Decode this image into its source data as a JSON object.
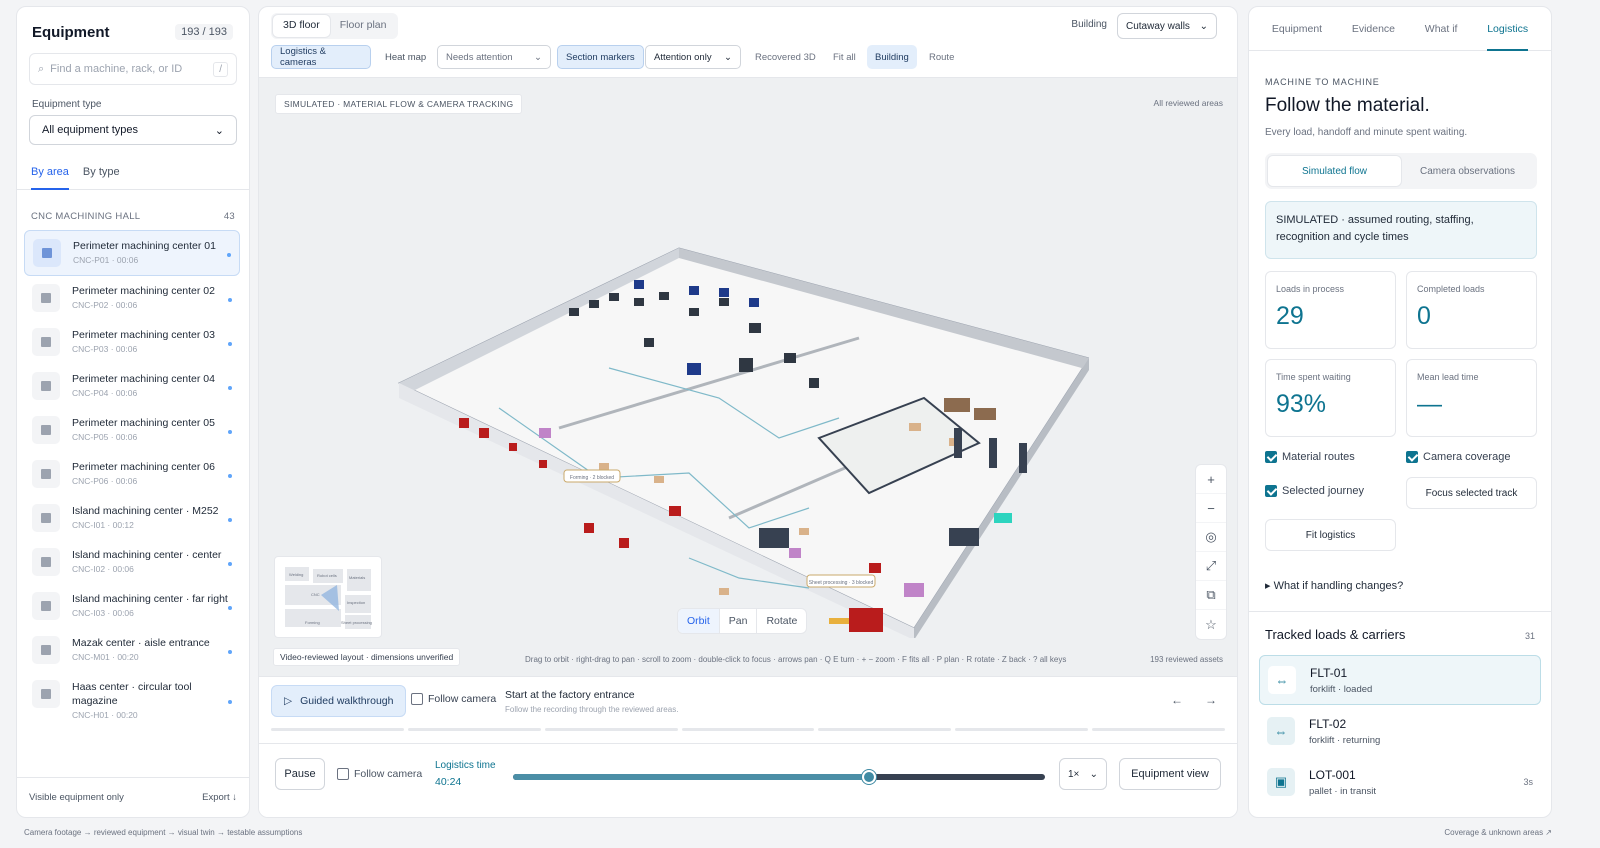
{
  "left": {
    "title": "Equipment",
    "count": "193 / 193",
    "search_placeholder": "Find a machine, rack, or ID",
    "search_shortcut": "/",
    "type_label": "Equipment type",
    "type_value": "All equipment types",
    "tabs": [
      "By area",
      "By type"
    ],
    "section_title": "CNC MACHINING HALL",
    "section_count": "43",
    "items": [
      {
        "name": "Perimeter machining center 01",
        "id": "CNC-P01 · 00:06"
      },
      {
        "name": "Perimeter machining center 02",
        "id": "CNC-P02 · 00:06"
      },
      {
        "name": "Perimeter machining center 03",
        "id": "CNC-P03 · 00:06"
      },
      {
        "name": "Perimeter machining center 04",
        "id": "CNC-P04 · 00:06"
      },
      {
        "name": "Perimeter machining center 05",
        "id": "CNC-P05 · 00:06"
      },
      {
        "name": "Perimeter machining center 06",
        "id": "CNC-P06 · 00:06"
      },
      {
        "name": "Island machining center · M252",
        "id": "CNC-I01 · 00:12"
      },
      {
        "name": "Island machining center · center",
        "id": "CNC-I02 · 00:06"
      },
      {
        "name": "Island machining center · far right",
        "id": "CNC-I03 · 00:06"
      },
      {
        "name": "Mazak center · aisle entrance",
        "id": "CNC-M01 · 00:20"
      },
      {
        "name": "Haas center · circular tool magazine",
        "id": "CNC-H01 · 00:20"
      }
    ],
    "footer_left": "Visible equipment only",
    "footer_right": "Export ↓"
  },
  "center": {
    "view_tabs": [
      "3D floor",
      "Floor plan"
    ],
    "building_label": "Building",
    "building_value": "Cutaway walls",
    "chips": {
      "logistics": "Logistics & cameras",
      "heatmap": "Heat map",
      "needs": "Needs attention",
      "section": "Section markers",
      "attention": "Attention only",
      "recovered": "Recovered 3D",
      "fitall": "Fit all",
      "building": "Building",
      "route": "Route"
    },
    "sim_tag": "SIMULATED · MATERIAL FLOW & CAMERA TRACKING",
    "reviewed_areas": "All reviewed areas",
    "scene_labels": {
      "forming": "Forming · 2 blocked",
      "sheet": "Sheet processing · 3 blocked"
    },
    "minimap_labels": [
      "Welding",
      "Robot cells",
      "Materials",
      "CNC",
      "Inspection",
      "Forming",
      "Sheet processing"
    ],
    "orbit_modes": [
      "Orbit",
      "Pan",
      "Rotate"
    ],
    "video_tag": "Video-reviewed layout · dimensions unverified",
    "hint": "Drag to orbit · right-drag to pan · scroll to zoom · double-click to focus · arrows pan · Q E turn · + − zoom · F fits all · P plan · R rotate · Z back · ? all keys",
    "reviewed_assets": "193 reviewed assets",
    "walkthrough": "Guided walkthrough",
    "follow_camera": "Follow camera",
    "walk_title": "Start at the factory entrance",
    "walk_sub": "Follow the recording through the reviewed areas.",
    "pause": "Pause",
    "logistics_time_label": "Logistics time",
    "logistics_time": "40:24",
    "timeline_position": 0.67,
    "speed": "1×",
    "equipment_view": "Equipment view"
  },
  "right": {
    "tabs": [
      "Equipment",
      "Evidence",
      "What if",
      "Logistics"
    ],
    "eyebrow": "MACHINE TO MACHINE",
    "title": "Follow the material.",
    "subtitle": "Every load, handoff and minute spent waiting.",
    "modes": [
      "Simulated flow",
      "Camera observations"
    ],
    "sim_note": "SIMULATED · assumed routing, staffing, recognition and cycle times",
    "stats": [
      {
        "label": "Loads in process",
        "value": "29"
      },
      {
        "label": "Completed loads",
        "value": "0"
      },
      {
        "label": "Time spent waiting",
        "value": "93%"
      },
      {
        "label": "Mean lead time",
        "value": "—"
      }
    ],
    "options": {
      "routes": "Material routes",
      "coverage": "Camera coverage",
      "journey": "Selected journey"
    },
    "focus_btn": "Focus selected track",
    "fit_btn": "Fit logistics",
    "whatif": "▸ What if handling changes?",
    "tracked_title": "Tracked loads & carriers",
    "tracked_count": "31",
    "tracks": [
      {
        "name": "FLT-01",
        "sub": "forklift · loaded",
        "right": ""
      },
      {
        "name": "FLT-02",
        "sub": "forklift · returning",
        "right": ""
      },
      {
        "name": "LOT-001",
        "sub": "pallet · in transit",
        "right": "3s"
      }
    ]
  },
  "footer": {
    "left": "Camera footage → reviewed equipment → visual twin → testable assumptions",
    "right": "Coverage & unknown areas ↗"
  },
  "colors": {
    "accent": "#0e7490",
    "blue": "#2563eb"
  }
}
